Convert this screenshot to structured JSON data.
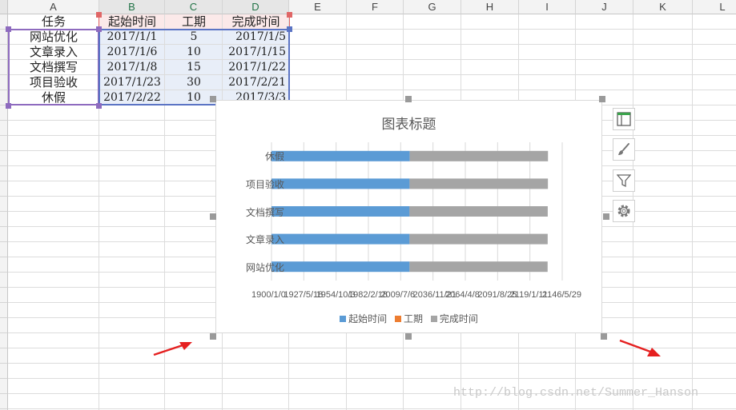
{
  "columns": [
    "A",
    "B",
    "C",
    "D",
    "E",
    "F",
    "G",
    "H",
    "I",
    "J",
    "K",
    "L"
  ],
  "table": {
    "headers": [
      "任务",
      "起始时间",
      "工期",
      "完成时间"
    ],
    "rows": [
      {
        "task": "网站优化",
        "start": "2017/1/1",
        "duration": "5",
        "end": "2017/1/5"
      },
      {
        "task": "文章录入",
        "start": "2017/1/6",
        "duration": "10",
        "end": "2017/1/15"
      },
      {
        "task": "文档撰写",
        "start": "2017/1/8",
        "duration": "15",
        "end": "2017/1/22"
      },
      {
        "task": "项目验收",
        "start": "2017/1/23",
        "duration": "30",
        "end": "2017/2/21"
      },
      {
        "task": "休假",
        "start": "2017/2/22",
        "duration": "10",
        "end": "2017/3/3"
      }
    ]
  },
  "chart_data": {
    "type": "bar",
    "orientation": "horizontal",
    "stacked": true,
    "title": "图表标题",
    "categories": [
      "网站优化",
      "文章录入",
      "文档撰写",
      "项目验收",
      "休假"
    ],
    "series": [
      {
        "name": "起始时间",
        "color": "#5b9bd5",
        "values": [
          42736,
          42741,
          42743,
          42758,
          42788
        ]
      },
      {
        "name": "工期",
        "color": "#ed7d31",
        "values": [
          5,
          10,
          15,
          30,
          10
        ]
      },
      {
        "name": "完成时间",
        "color": "#a5a5a5",
        "values": [
          42740,
          42750,
          42757,
          42787,
          42797
        ]
      }
    ],
    "x_tick_labels": [
      "1900/1/0",
      "1927/5/18",
      "1954/10/3",
      "1982/2/18",
      "2009/7/6",
      "2036/11/21",
      "2064/4/8",
      "2091/8/25",
      "2119/1/11",
      "2146/5/29"
    ],
    "xlim": [
      0,
      90000
    ],
    "grid": true,
    "legend": "bottom"
  },
  "chart_tools": [
    {
      "name": "chart-elements-button",
      "icon": "layout-icon"
    },
    {
      "name": "chart-styles-button",
      "icon": "brush-icon"
    },
    {
      "name": "chart-filters-button",
      "icon": "filter-icon"
    },
    {
      "name": "chart-settings-button",
      "icon": "gear-icon"
    }
  ],
  "watermark": "http://blog.csdn.net/Summer_Hanson"
}
